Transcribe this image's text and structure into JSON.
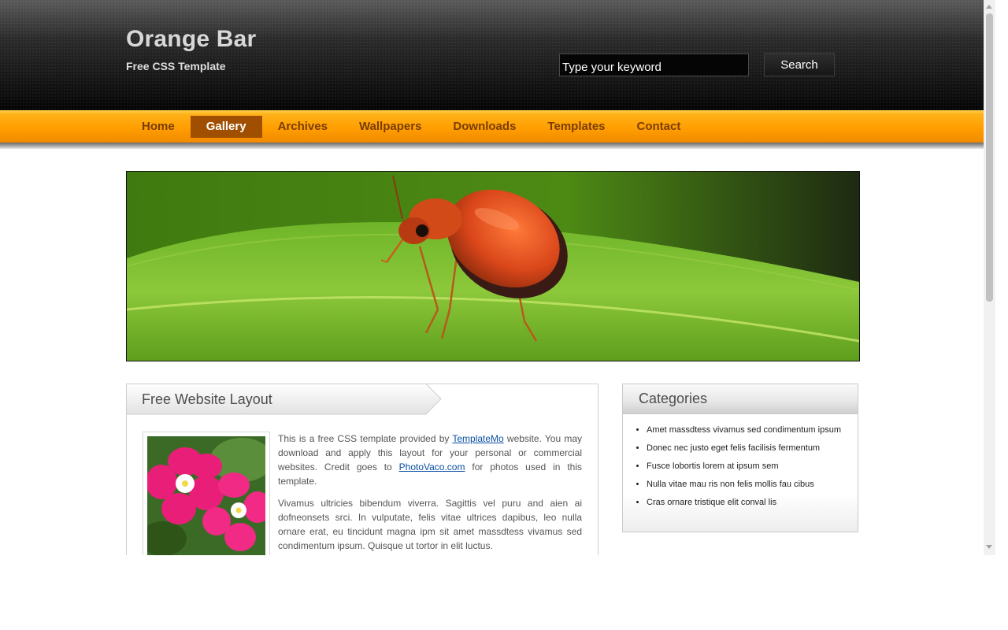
{
  "header": {
    "title": "Orange Bar",
    "tagline": "Free CSS Template",
    "search_placeholder": "Type your keyword",
    "search_button": "Search"
  },
  "nav": {
    "items": [
      {
        "label": "Home"
      },
      {
        "label": "Gallery",
        "active": true
      },
      {
        "label": "Archives"
      },
      {
        "label": "Wallpapers"
      },
      {
        "label": "Downloads"
      },
      {
        "label": "Templates"
      },
      {
        "label": "Contact"
      }
    ]
  },
  "main": {
    "section_title": "Free Website Layout",
    "p1": {
      "t1": "This is a free CSS template provided by ",
      "link1": "TemplateMo",
      "t2": " website. You may download and apply this layout for your personal or commercial websites. Credit goes to ",
      "link2": "PhotoVaco.com",
      "t3": " for photos used in this template."
    },
    "p2": "Vivamus ultricies bibendum viverra. Sagittis vel puru and aien ai dofneonsets srci. In vulputate, felis vitae ultrices dapibus, leo nulla ornare erat, eu tincidunt magna ipm sit amet massdtess vivamus sed condimentum ipsum. Quisque ut tortor in elit luctus."
  },
  "sidebar": {
    "title": "Categories",
    "items": [
      "Amet massdtess vivamus sed condimentum ipsum",
      "Donec nec justo eget felis facilisis fermentum",
      "Fusce lobortis lorem at ipsum sem",
      "Nulla vitae mau ris non felis mollis fau cibus",
      "Cras ornare tristique elit conval lis"
    ]
  },
  "colors": {
    "nav_orange": "#ff9e00",
    "nav_active": "#a04f00",
    "nav_text": "#7a3d00",
    "link": "#0b4ea2"
  },
  "icons": {
    "banner": "beetle-on-leaf-photo",
    "photo": "pink-flowers-photo"
  }
}
